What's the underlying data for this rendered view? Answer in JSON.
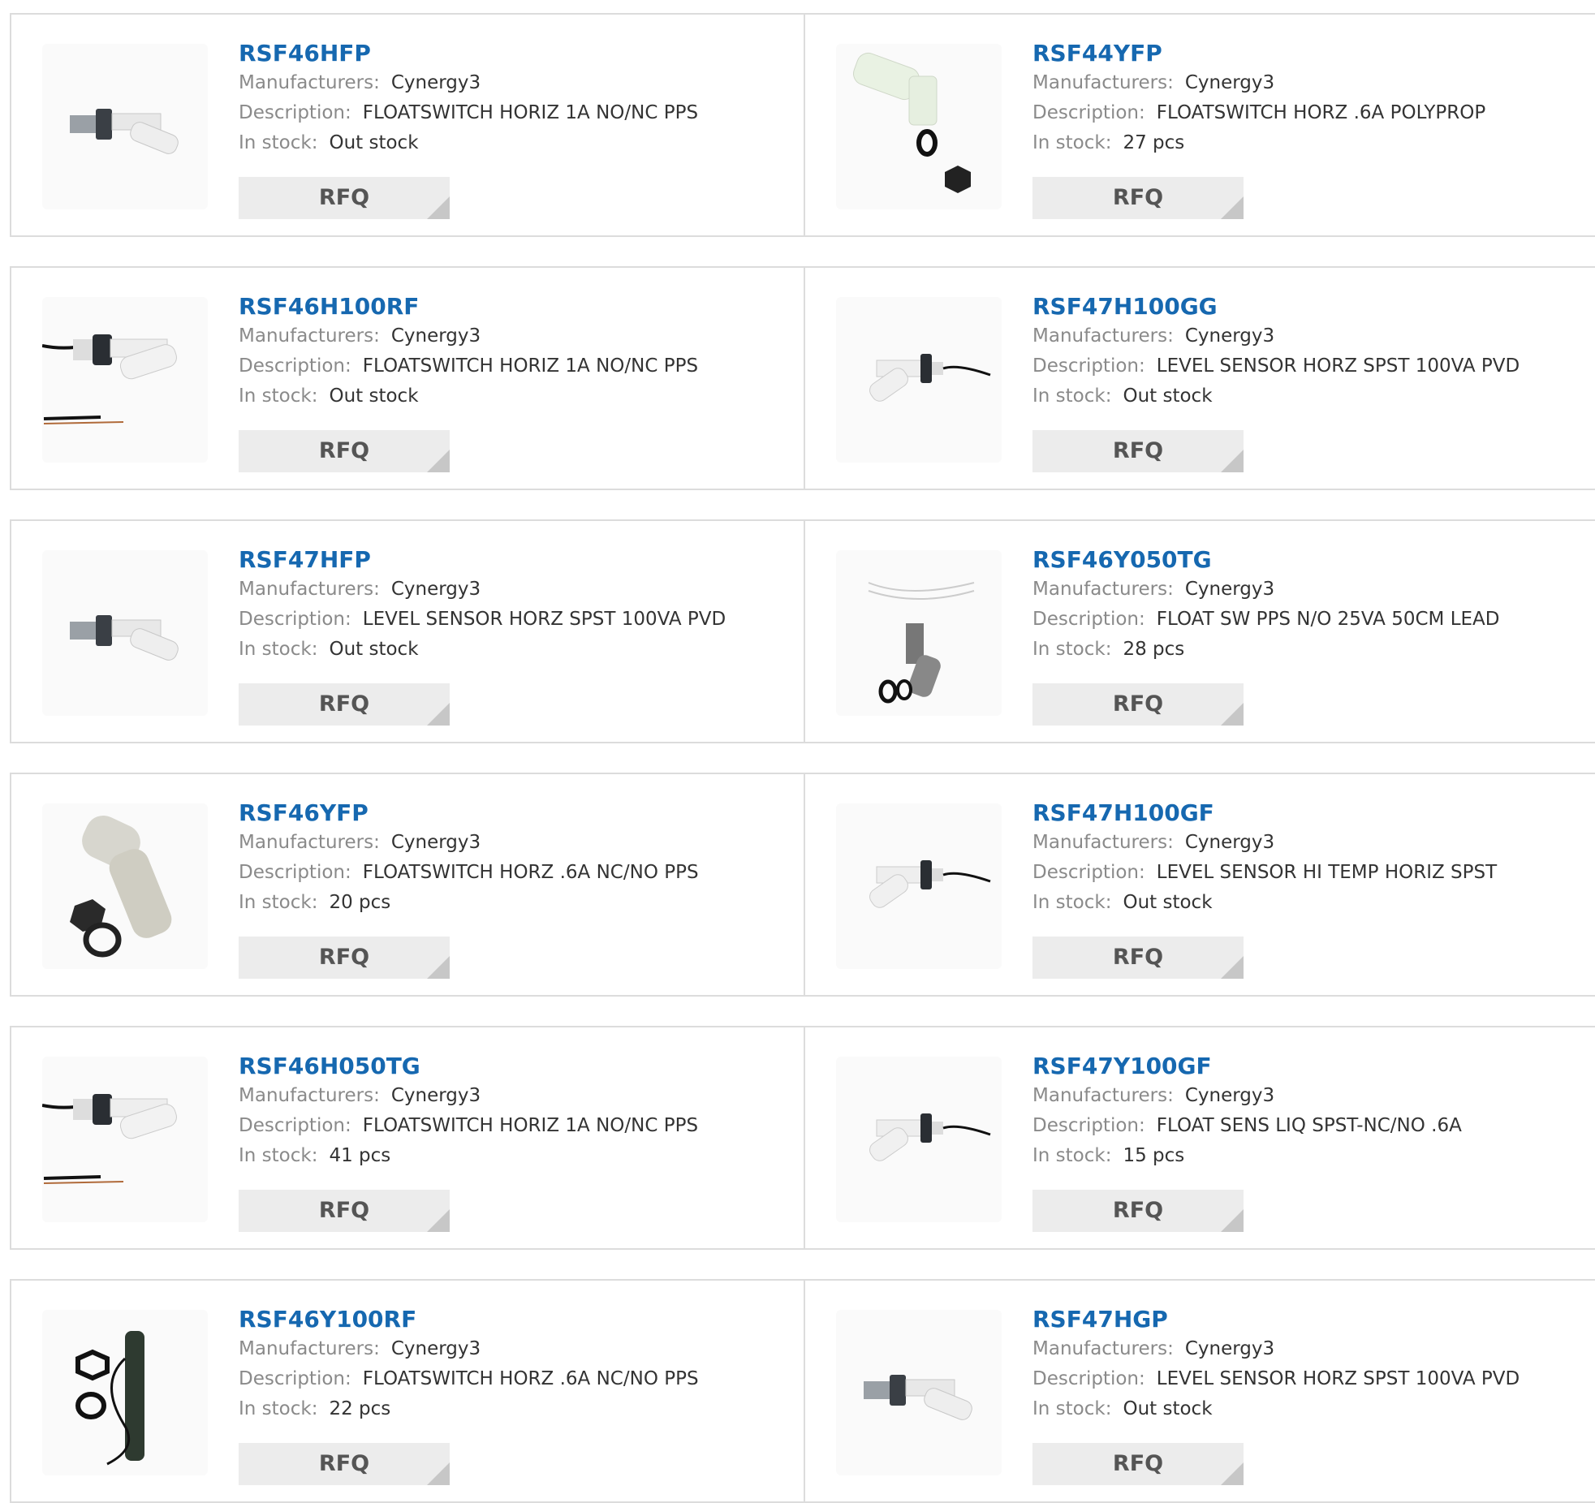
{
  "labels": {
    "manufacturer": "Manufacturers:",
    "description": "Description:",
    "stock": "In stock:",
    "rfq": "RFQ"
  },
  "products": [
    {
      "part": "RSF46HFP",
      "manufacturer": "Cynergy3",
      "description": "FLOATSWITCH HORIZ 1A NO/NC PPS",
      "stock": "Out stock",
      "image": "float-switch-horizontal-icon"
    },
    {
      "part": "RSF44YFP",
      "manufacturer": "Cynergy3",
      "description": "FLOATSWITCH HORZ .6A POLYPROP",
      "stock": "27 pcs",
      "image": "float-switch-vertical-icon"
    },
    {
      "part": "RSF46H100RF",
      "manufacturer": "Cynergy3",
      "description": "FLOATSWITCH HORIZ 1A NO/NC PPS",
      "stock": "Out stock",
      "image": "float-switch-wired-icon"
    },
    {
      "part": "RSF47H100GG",
      "manufacturer": "Cynergy3",
      "description": "LEVEL SENSOR HORZ SPST 100VA PVD",
      "stock": "Out stock",
      "image": "level-sensor-cable-icon"
    },
    {
      "part": "RSF47HFP",
      "manufacturer": "Cynergy3",
      "description": "LEVEL SENSOR HORZ SPST 100VA PVD",
      "stock": "Out stock",
      "image": "float-switch-horizontal-icon"
    },
    {
      "part": "RSF46Y050TG",
      "manufacturer": "Cynergy3",
      "description": "FLOAT SW PPS N/O 25VA 50CM LEAD",
      "stock": "28 pcs",
      "image": "float-switch-lead-icon"
    },
    {
      "part": "RSF46YFP",
      "manufacturer": "Cynergy3",
      "description": "FLOATSWITCH HORZ .6A NC/NO PPS",
      "stock": "20 pcs",
      "image": "float-switch-body-icon"
    },
    {
      "part": "RSF47H100GF",
      "manufacturer": "Cynergy3",
      "description": "LEVEL SENSOR HI TEMP HORIZ SPST",
      "stock": "Out stock",
      "image": "level-sensor-cable-icon"
    },
    {
      "part": "RSF46H050TG",
      "manufacturer": "Cynergy3",
      "description": "FLOATSWITCH HORIZ 1A NO/NC PPS",
      "stock": "41 pcs",
      "image": "float-switch-wired-icon"
    },
    {
      "part": "RSF47Y100GF",
      "manufacturer": "Cynergy3",
      "description": "FLOAT SENS LIQ SPST-NC/NO .6A",
      "stock": "15 pcs",
      "image": "level-sensor-cable-icon"
    },
    {
      "part": "RSF46Y100RF",
      "manufacturer": "Cynergy3",
      "description": "FLOATSWITCH HORZ .6A NC/NO PPS",
      "stock": "22 pcs",
      "image": "float-switch-dark-icon"
    },
    {
      "part": "RSF47HGP",
      "manufacturer": "Cynergy3",
      "description": "LEVEL SENSOR HORZ SPST 100VA PVD",
      "stock": "Out stock",
      "image": "float-switch-horizontal-icon"
    }
  ],
  "colors": {
    "link": "#1668b0",
    "label": "#8a8a8a",
    "border": "#dcdcdc",
    "button": "#ececec"
  }
}
